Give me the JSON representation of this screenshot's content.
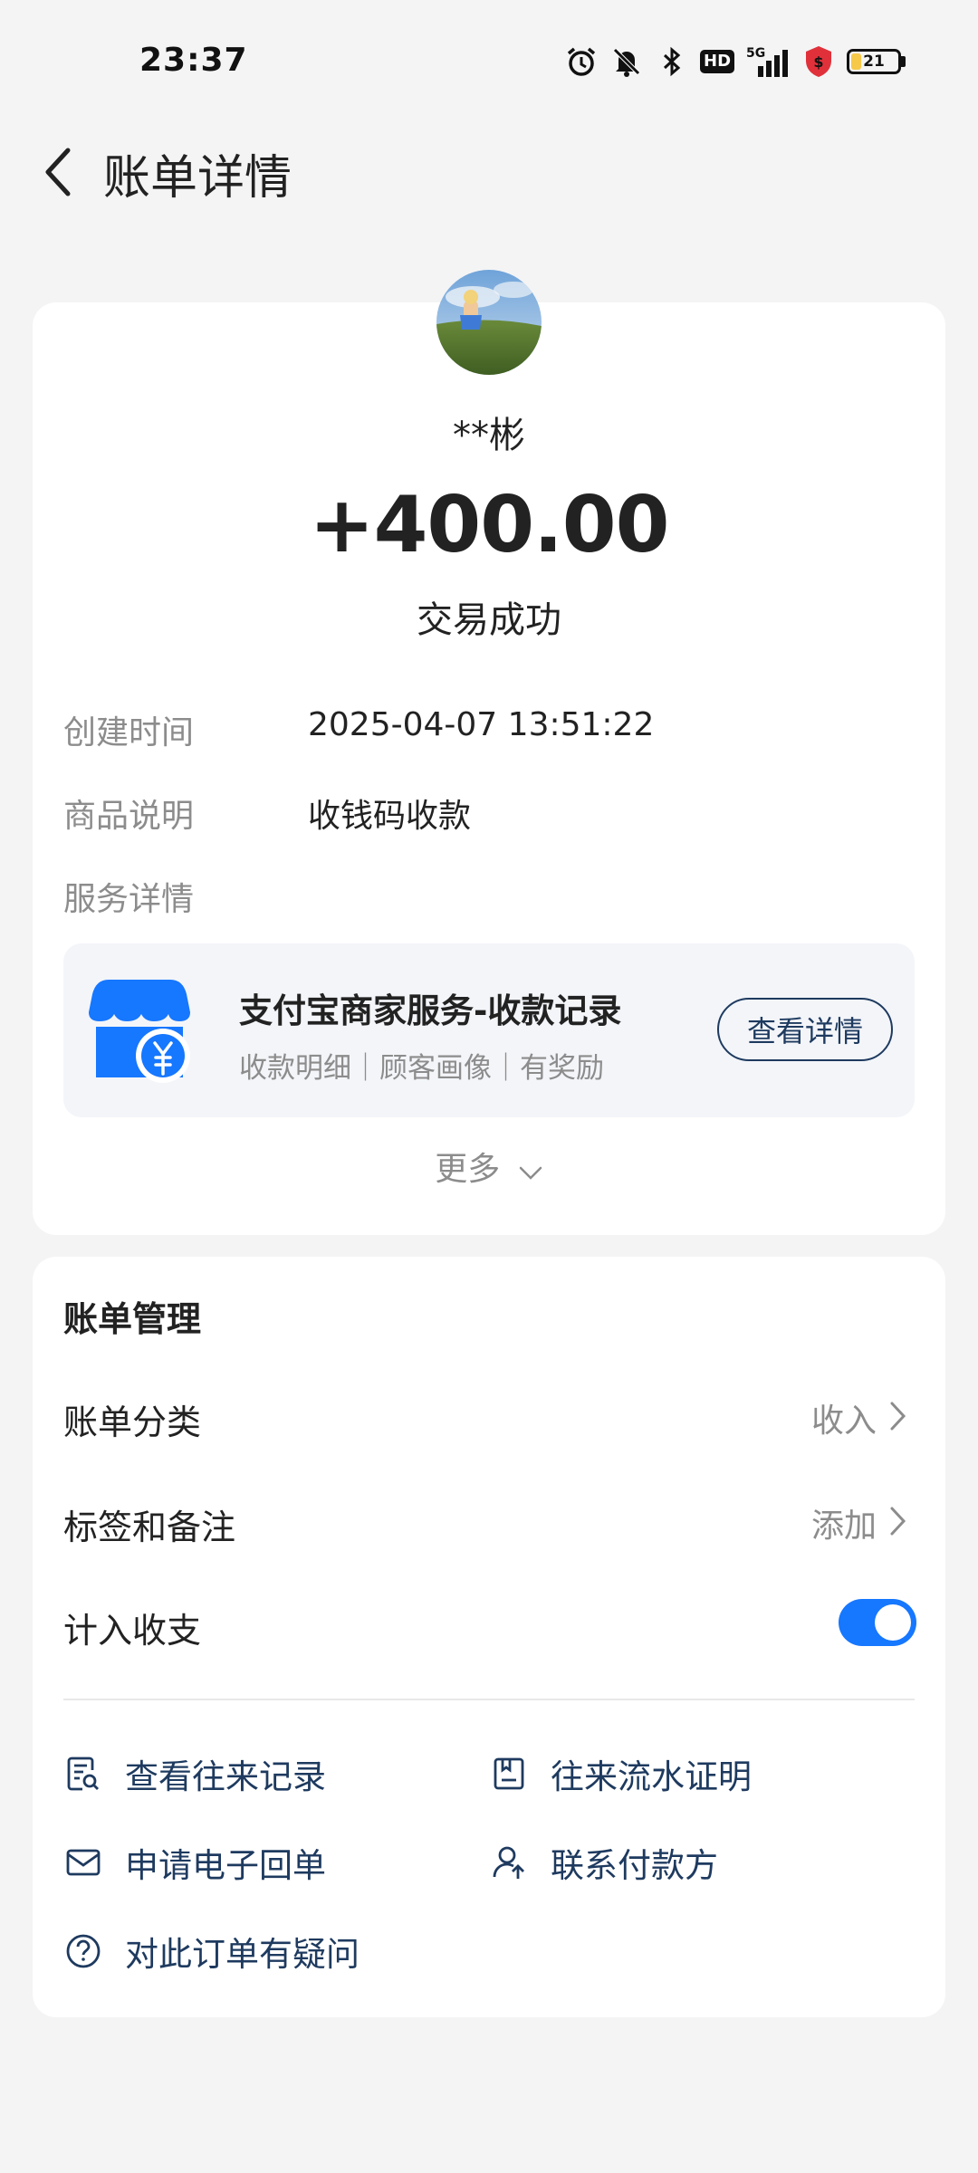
{
  "status_bar": {
    "time": "23:37",
    "network": "5G",
    "hd": "HD",
    "battery": "21",
    "battery_level": 0.21,
    "icons": [
      "alarm-icon",
      "mute-icon",
      "bluetooth-icon",
      "hd-icon",
      "signal-5g-icon",
      "security-shield-icon",
      "battery-icon"
    ]
  },
  "header": {
    "title": "账单详情",
    "back_icon": "chevron-left-icon"
  },
  "transaction": {
    "payer_name": "**彬",
    "amount": "+400.00",
    "status": "交易成功",
    "details": [
      {
        "label": "创建时间",
        "value": "2025-04-07 13:51:22"
      },
      {
        "label": "商品说明",
        "value": "收钱码收款"
      }
    ],
    "service_label": "服务详情"
  },
  "service_card": {
    "title": "支付宝商家服务-收款记录",
    "subtitle": "收款明细｜顾客画像｜有奖励",
    "button": "查看详情",
    "icon": "merchant-shop-icon",
    "accent_color": "#1677ff"
  },
  "more": {
    "label": "更多"
  },
  "bill_management": {
    "title": "账单管理",
    "rows": [
      {
        "label": "账单分类",
        "value": "收入"
      },
      {
        "label": "标签和备注",
        "value": "添加"
      },
      {
        "label": "计入收支",
        "toggle": true
      }
    ],
    "links": [
      {
        "label": "查看往来记录",
        "icon": "records-search-icon"
      },
      {
        "label": "往来流水证明",
        "icon": "statement-proof-icon"
      },
      {
        "label": "申请电子回单",
        "icon": "mail-receipt-icon"
      },
      {
        "label": "联系付款方",
        "icon": "contact-payer-icon"
      },
      {
        "label": "对此订单有疑问",
        "icon": "question-circle-icon"
      }
    ]
  },
  "colors": {
    "background": "#f4f4f5",
    "card": "#ffffff",
    "link_text": "#1e3a5f",
    "toggle_on": "#1677ff",
    "muted_text": "#8c8c8c"
  }
}
